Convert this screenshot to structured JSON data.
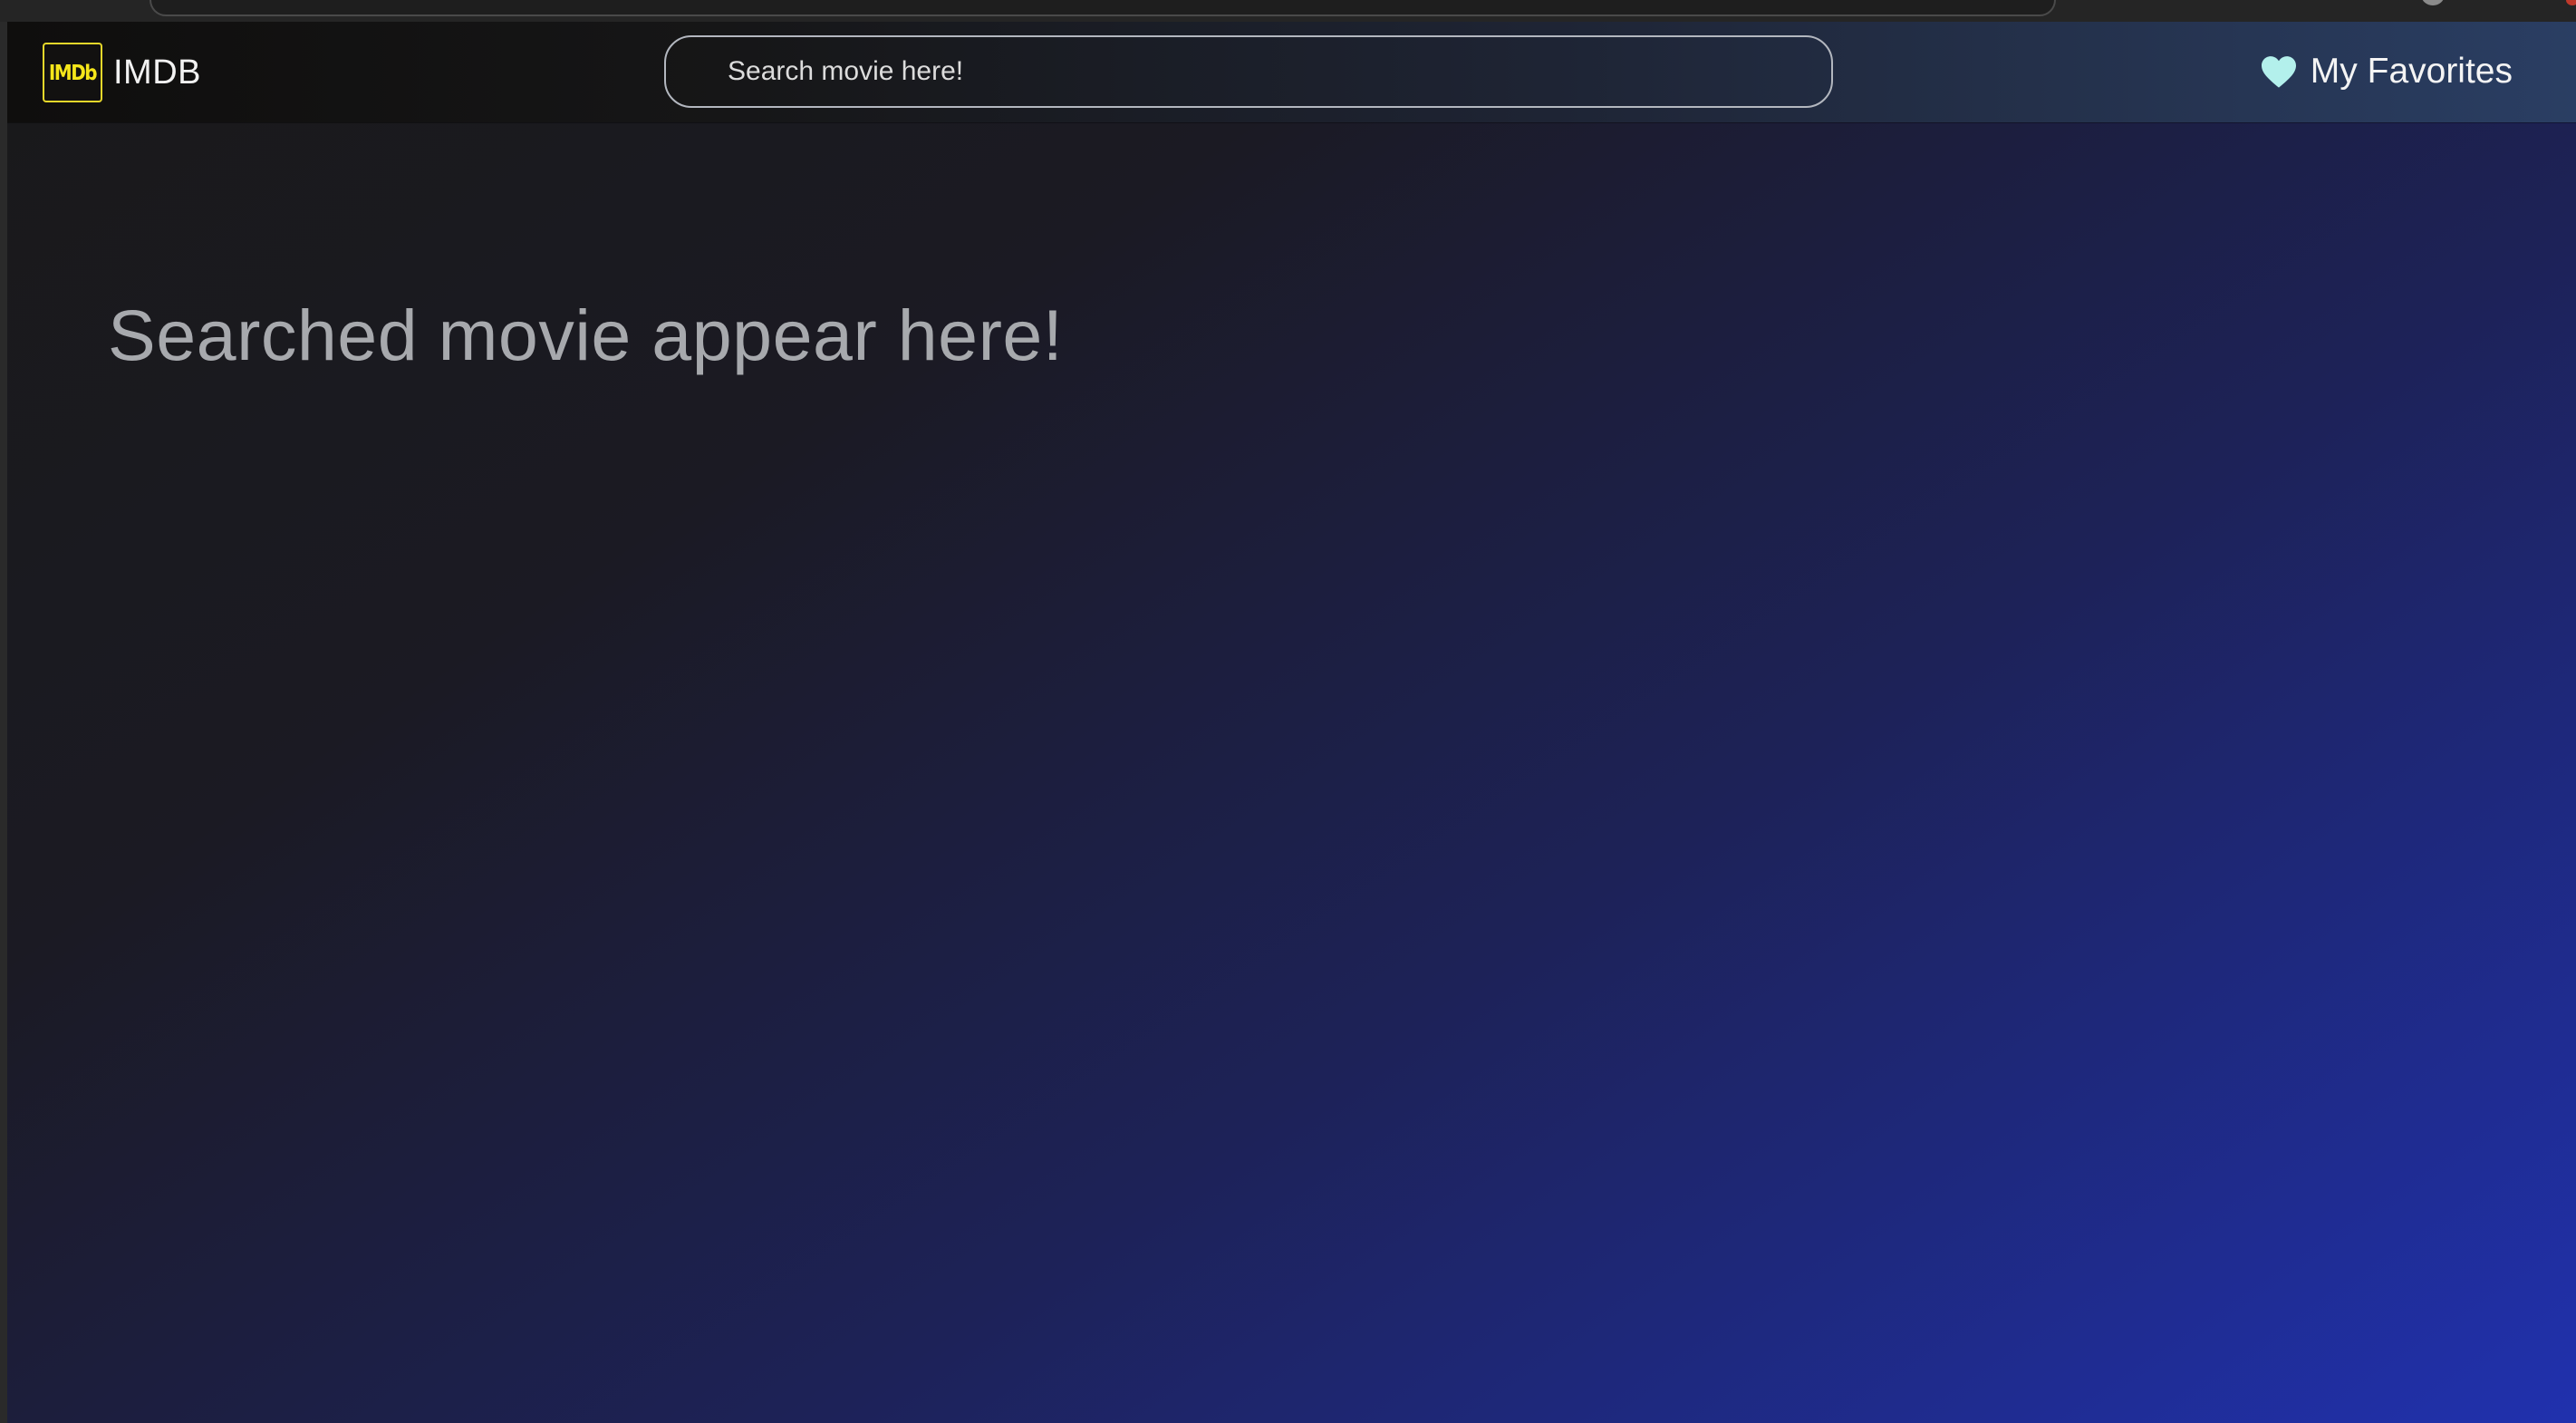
{
  "navbar": {
    "logo_text": "IMDb",
    "brand_name": "IMDB",
    "search": {
      "placeholder": "Search movie here!"
    },
    "favorites": {
      "label": "My Favorites",
      "icon": "heart-icon",
      "icon_color": "#b3f0ec"
    }
  },
  "main": {
    "placeholder_message": "Searched movie appear here!"
  },
  "colors": {
    "logo_yellow": "#f5e61a",
    "gradient_dark": "#19191a",
    "gradient_blue": "#2031ae"
  }
}
